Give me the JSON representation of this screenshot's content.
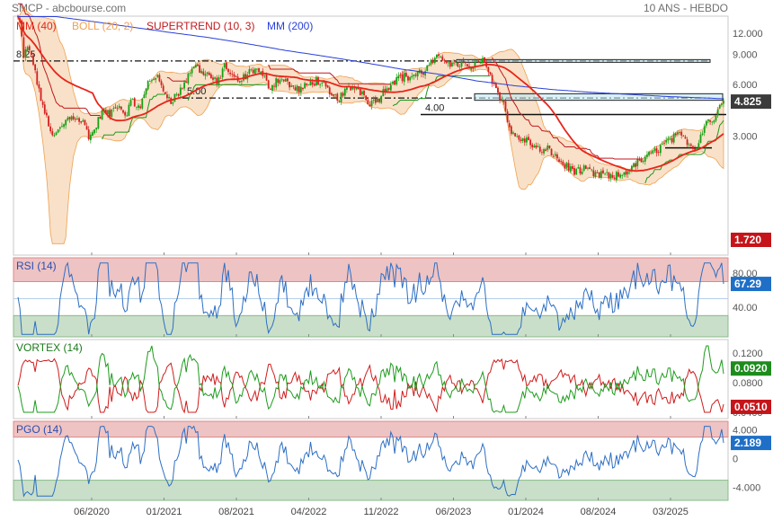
{
  "header": {
    "left": "SMCP - abcbourse.com",
    "right": "10 ANS - HEBDO"
  },
  "x_axis": {
    "labels": [
      "06/2020",
      "01/2021",
      "08/2021",
      "04/2022",
      "11/2022",
      "06/2023",
      "01/2024",
      "08/2024",
      "03/2025"
    ]
  },
  "colors": {
    "mm40": "#e8251b",
    "boll": "#f0a050",
    "supertrend": "#c0191e",
    "mm200": "#2a3fd8",
    "rsi": "#2d6fc4",
    "vortex_pos": "#1e9b1e",
    "vortex_neg": "#cf1c1c",
    "pgo": "#2d6fc4",
    "badge_blue": "#1f6fc7",
    "badge_red": "#c5141a",
    "badge_green": "#1d8c1d",
    "zone_red": "#eec3c3",
    "zone_green": "#c9dfc9"
  },
  "chart_data": [
    {
      "type": "candlestick",
      "panel": "price",
      "legend": [
        "MM (40)",
        "BOLL (20, 2)",
        "SUPERTREND (10, 3)",
        "MM (200)"
      ],
      "yticks": [
        "12.000",
        "9.000",
        "6.000",
        "3.000"
      ],
      "ytick_values": [
        12,
        9,
        6,
        3
      ],
      "ylim": [
        0.6,
        15.1
      ],
      "log_scale": true,
      "levels": [
        {
          "label": "8.25",
          "value": 8.25,
          "style": "dash-dot"
        },
        {
          "label": "5.00",
          "value": 5.0,
          "style": "dash-dot"
        },
        {
          "label": "4.00",
          "value": 4.0,
          "style": "solid"
        }
      ],
      "last_price_label": "4.825",
      "last_price": 4.825,
      "supertrend_label": "1.720",
      "supertrend_value": 1.72,
      "anchors": [
        [
          0,
          14.8
        ],
        [
          1,
          13.5
        ],
        [
          2,
          11.2
        ],
        [
          3,
          8.8
        ],
        [
          5,
          9.8
        ],
        [
          7,
          9.0
        ],
        [
          9,
          6.9
        ],
        [
          11,
          5.6
        ],
        [
          13,
          4.3
        ],
        [
          15,
          3.9
        ],
        [
          18,
          2.9
        ],
        [
          22,
          3.3
        ],
        [
          26,
          3.8
        ],
        [
          30,
          3.9
        ],
        [
          34,
          3.6
        ],
        [
          37,
          3.0
        ],
        [
          40,
          3.2
        ],
        [
          44,
          4.2
        ],
        [
          48,
          4.0
        ],
        [
          52,
          4.6
        ],
        [
          56,
          4.0
        ],
        [
          60,
          4.8
        ],
        [
          64,
          4.3
        ],
        [
          68,
          6.2
        ],
        [
          72,
          6.8
        ],
        [
          76,
          5.5
        ],
        [
          80,
          4.9
        ],
        [
          84,
          5.3
        ],
        [
          88,
          6.4
        ],
        [
          92,
          7.8
        ],
        [
          96,
          7.2
        ],
        [
          100,
          6.8
        ],
        [
          104,
          6.0
        ],
        [
          108,
          7.8
        ],
        [
          112,
          6.6
        ],
        [
          116,
          6.2
        ],
        [
          120,
          6.9
        ],
        [
          124,
          7.5
        ],
        [
          128,
          6.7
        ],
        [
          132,
          5.8
        ],
        [
          136,
          6.5
        ],
        [
          140,
          6.3
        ],
        [
          144,
          5.7
        ],
        [
          148,
          5.6
        ],
        [
          152,
          6.0
        ],
        [
          156,
          6.4
        ],
        [
          160,
          5.8
        ],
        [
          164,
          5.1
        ],
        [
          168,
          5.0
        ],
        [
          172,
          5.6
        ],
        [
          176,
          5.8
        ],
        [
          180,
          5.4
        ],
        [
          184,
          4.7
        ],
        [
          188,
          4.9
        ],
        [
          192,
          5.6
        ],
        [
          196,
          6.3
        ],
        [
          200,
          6.7
        ],
        [
          204,
          6.6
        ],
        [
          208,
          6.9
        ],
        [
          212,
          7.1
        ],
        [
          216,
          8.0
        ],
        [
          220,
          8.6
        ],
        [
          224,
          8.4
        ],
        [
          228,
          7.8
        ],
        [
          232,
          8.0
        ],
        [
          236,
          7.4
        ],
        [
          240,
          7.9
        ],
        [
          244,
          8.5
        ],
        [
          246,
          7.2
        ],
        [
          248,
          6.2
        ],
        [
          250,
          5.8
        ],
        [
          252,
          5.2
        ],
        [
          254,
          4.6
        ],
        [
          256,
          3.7
        ],
        [
          258,
          3.1
        ],
        [
          262,
          2.9
        ],
        [
          266,
          2.8
        ],
        [
          270,
          2.6
        ],
        [
          274,
          2.4
        ],
        [
          278,
          2.5
        ],
        [
          282,
          2.2
        ],
        [
          286,
          2.0
        ],
        [
          290,
          1.9
        ],
        [
          294,
          1.85
        ],
        [
          298,
          1.9
        ],
        [
          302,
          1.75
        ],
        [
          306,
          1.8
        ],
        [
          310,
          1.7
        ],
        [
          314,
          1.75
        ],
        [
          318,
          1.85
        ],
        [
          322,
          2.0
        ],
        [
          326,
          2.15
        ],
        [
          330,
          2.3
        ],
        [
          334,
          2.5
        ],
        [
          338,
          2.7
        ],
        [
          342,
          2.9
        ],
        [
          346,
          3.0
        ],
        [
          350,
          2.8
        ],
        [
          354,
          2.5
        ],
        [
          356,
          2.8
        ],
        [
          358,
          3.3
        ],
        [
          361,
          3.8
        ],
        [
          363,
          3.6
        ],
        [
          366,
          4.2
        ],
        [
          369,
          4.825
        ]
      ],
      "mm200_anchors": [
        [
          20,
          15.0
        ],
        [
          40,
          14.0
        ],
        [
          60,
          13.0
        ],
        [
          80,
          12.1
        ],
        [
          100,
          11.3
        ],
        [
          120,
          10.4
        ],
        [
          140,
          9.5
        ],
        [
          160,
          8.8
        ],
        [
          180,
          8.1
        ],
        [
          200,
          7.4
        ],
        [
          220,
          6.9
        ],
        [
          240,
          6.3
        ],
        [
          260,
          5.9
        ],
        [
          280,
          5.6
        ],
        [
          300,
          5.4
        ],
        [
          320,
          5.25
        ],
        [
          340,
          5.1
        ],
        [
          360,
          5.0
        ],
        [
          369,
          4.95
        ]
      ]
    },
    {
      "type": "line",
      "panel": "rsi",
      "series_name": "RSI (14)",
      "yticks": [
        "80.00",
        "40.00"
      ],
      "ytick_values": [
        80,
        40
      ],
      "ylim": [
        5,
        98
      ],
      "zones": {
        "upper": [
          70,
          98
        ],
        "lower": [
          5,
          30
        ]
      },
      "midline": 50,
      "last_label": "67.29",
      "last_value": 67.29
    },
    {
      "type": "line",
      "panel": "vortex",
      "series_name": "VORTEX (14)",
      "yticks": [
        "0.1200",
        "0.0800",
        "0.0400"
      ],
      "ytick_values": [
        0.12,
        0.08,
        0.04
      ],
      "ylim": [
        0.0315,
        0.1385
      ],
      "pos_label": "0.0920",
      "pos_value": 0.092,
      "neg_label": "0.0510",
      "neg_value": 0.051
    },
    {
      "type": "line",
      "panel": "pgo",
      "series_name": "PGO (14)",
      "yticks": [
        "4.000",
        "0",
        "-4.000"
      ],
      "ytick_values": [
        4,
        0,
        -4
      ],
      "ylim": [
        -5.8,
        5.2
      ],
      "zones": {
        "upper": [
          3,
          5.2
        ],
        "lower": [
          -5.8,
          -3
        ]
      },
      "last_label": "2.189",
      "last_value": 2.189
    }
  ]
}
